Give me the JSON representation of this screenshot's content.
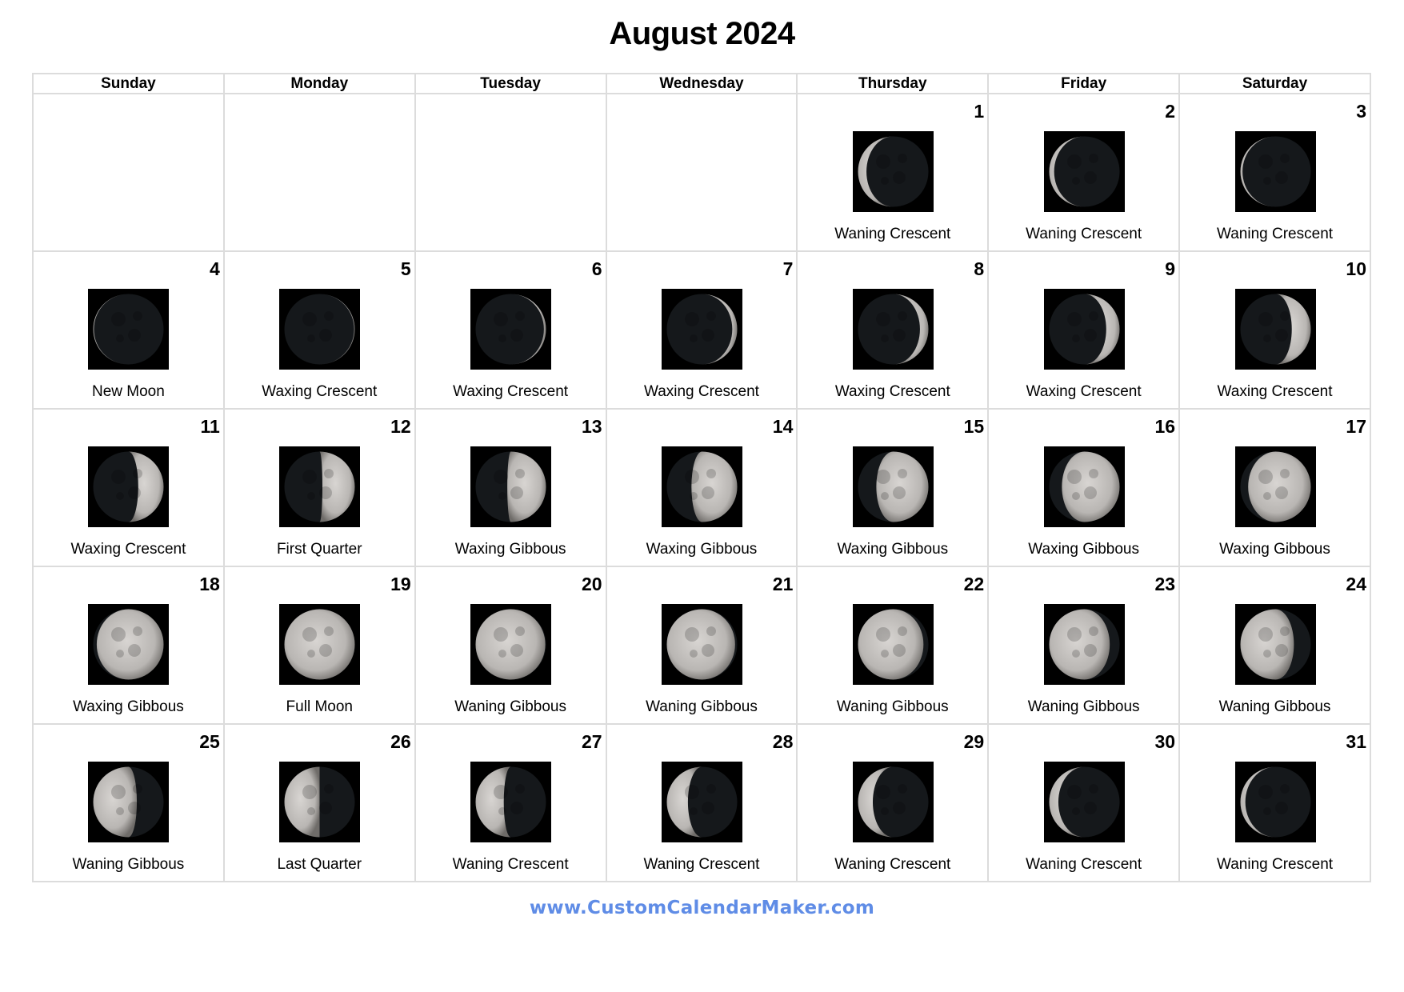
{
  "title": "August 2024",
  "weekdays": [
    "Sunday",
    "Monday",
    "Tuesday",
    "Wednesday",
    "Thursday",
    "Friday",
    "Saturday"
  ],
  "first_weekday_index": 4,
  "days": [
    {
      "day": "1",
      "phase": "Waning Crescent",
      "illumination": 0.12,
      "lit_side": "left"
    },
    {
      "day": "2",
      "phase": "Waning Crescent",
      "illumination": 0.07,
      "lit_side": "left"
    },
    {
      "day": "3",
      "phase": "Waning Crescent",
      "illumination": 0.03,
      "lit_side": "left"
    },
    {
      "day": "4",
      "phase": "New Moon",
      "illumination": 0.01,
      "lit_side": "left"
    },
    {
      "day": "5",
      "phase": "Waxing Crescent",
      "illumination": 0.01,
      "lit_side": "right"
    },
    {
      "day": "6",
      "phase": "Waxing Crescent",
      "illumination": 0.03,
      "lit_side": "right"
    },
    {
      "day": "7",
      "phase": "Waxing Crescent",
      "illumination": 0.07,
      "lit_side": "right"
    },
    {
      "day": "8",
      "phase": "Waxing Crescent",
      "illumination": 0.12,
      "lit_side": "right"
    },
    {
      "day": "9",
      "phase": "Waxing Crescent",
      "illumination": 0.19,
      "lit_side": "right"
    },
    {
      "day": "10",
      "phase": "Waxing Crescent",
      "illumination": 0.27,
      "lit_side": "right"
    },
    {
      "day": "11",
      "phase": "Waxing Crescent",
      "illumination": 0.36,
      "lit_side": "right"
    },
    {
      "day": "12",
      "phase": "First Quarter",
      "illumination": 0.46,
      "lit_side": "right"
    },
    {
      "day": "13",
      "phase": "Waxing Gibbous",
      "illumination": 0.55,
      "lit_side": "right"
    },
    {
      "day": "14",
      "phase": "Waxing Gibbous",
      "illumination": 0.65,
      "lit_side": "right"
    },
    {
      "day": "15",
      "phase": "Waxing Gibbous",
      "illumination": 0.74,
      "lit_side": "right"
    },
    {
      "day": "16",
      "phase": "Waxing Gibbous",
      "illumination": 0.82,
      "lit_side": "right"
    },
    {
      "day": "17",
      "phase": "Waxing Gibbous",
      "illumination": 0.89,
      "lit_side": "right"
    },
    {
      "day": "18",
      "phase": "Waxing Gibbous",
      "illumination": 0.95,
      "lit_side": "right"
    },
    {
      "day": "19",
      "phase": "Full Moon",
      "illumination": 1.0,
      "lit_side": "right"
    },
    {
      "day": "20",
      "phase": "Waning Gibbous",
      "illumination": 0.99,
      "lit_side": "left"
    },
    {
      "day": "21",
      "phase": "Waning Gibbous",
      "illumination": 0.97,
      "lit_side": "left"
    },
    {
      "day": "22",
      "phase": "Waning Gibbous",
      "illumination": 0.93,
      "lit_side": "left"
    },
    {
      "day": "23",
      "phase": "Waning Gibbous",
      "illumination": 0.86,
      "lit_side": "left"
    },
    {
      "day": "24",
      "phase": "Waning Gibbous",
      "illumination": 0.76,
      "lit_side": "left"
    },
    {
      "day": "25",
      "phase": "Waning Gibbous",
      "illumination": 0.62,
      "lit_side": "left"
    },
    {
      "day": "26",
      "phase": "Last Quarter",
      "illumination": 0.5,
      "lit_side": "left"
    },
    {
      "day": "27",
      "phase": "Waning Crescent",
      "illumination": 0.4,
      "lit_side": "left"
    },
    {
      "day": "28",
      "phase": "Waning Crescent",
      "illumination": 0.3,
      "lit_side": "left"
    },
    {
      "day": "29",
      "phase": "Waning Crescent",
      "illumination": 0.21,
      "lit_side": "left"
    },
    {
      "day": "30",
      "phase": "Waning Crescent",
      "illumination": 0.13,
      "lit_side": "left"
    },
    {
      "day": "31",
      "phase": "Waning Crescent",
      "illumination": 0.07,
      "lit_side": "left"
    }
  ],
  "colors": {
    "moon_lit": "#b9b6b3",
    "moon_dark": "#15181b",
    "background": "#000000",
    "grid_line": "#dcdcdc",
    "footer_text": "#5f8ce6"
  },
  "footer": "www.CustomCalendarMaker.com"
}
